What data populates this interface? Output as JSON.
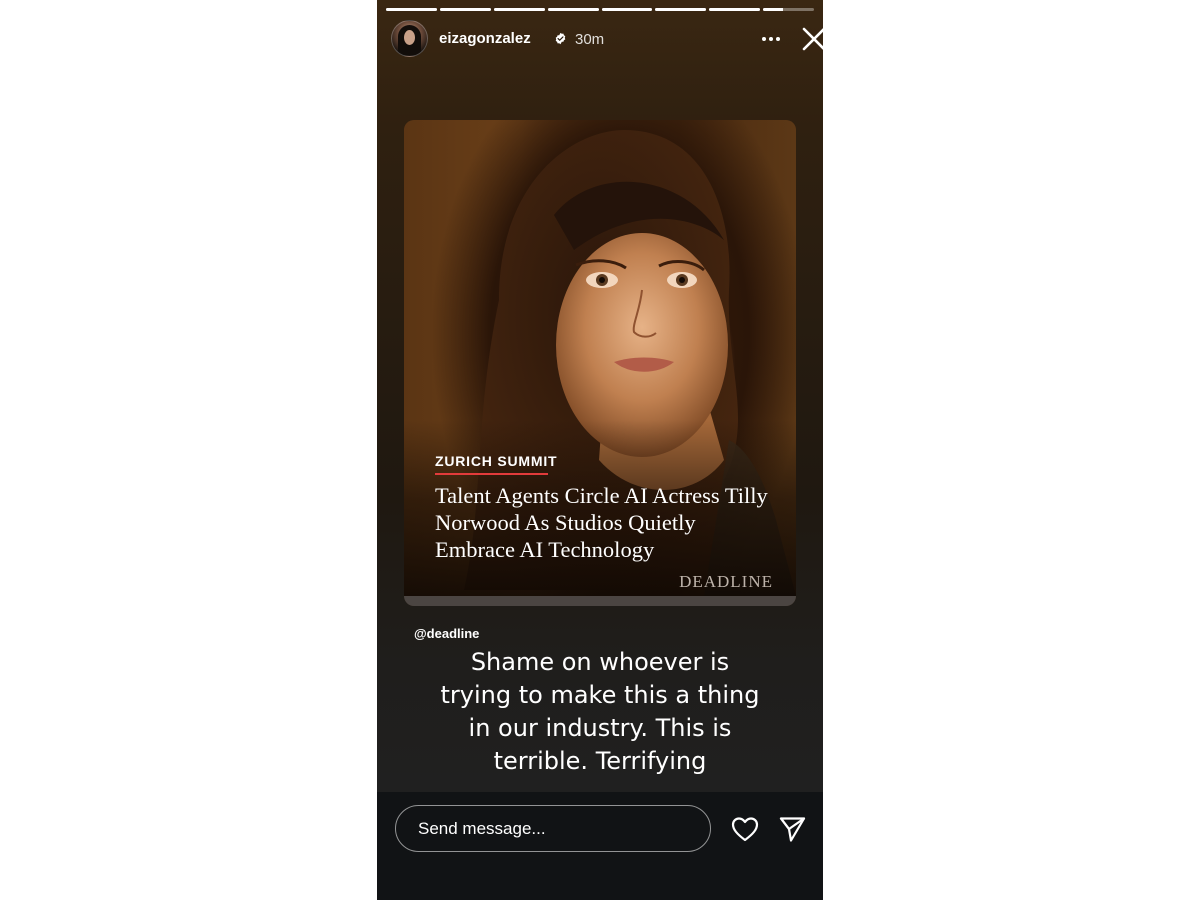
{
  "story": {
    "username": "eizagonzalez",
    "time_ago": "30m",
    "progress_segments": [
      1,
      1,
      1,
      1,
      1,
      1,
      1,
      0.4
    ]
  },
  "shared_post": {
    "kicker": "ZURICH SUMMIT",
    "headline": "Talent Agents Circle AI Actress Tilly Norwood As Studios Quietly Embrace AI Technology",
    "brand": "DEADLINE",
    "mention": "@deadline"
  },
  "caption": "Shame on whoever is trying to make this a thing in our industry. This is terrible. Terrifying",
  "reply": {
    "placeholder": "Send message..."
  },
  "colors": {
    "kicker_underline": "#e23b3b",
    "verified_badge": "#ffffff"
  }
}
